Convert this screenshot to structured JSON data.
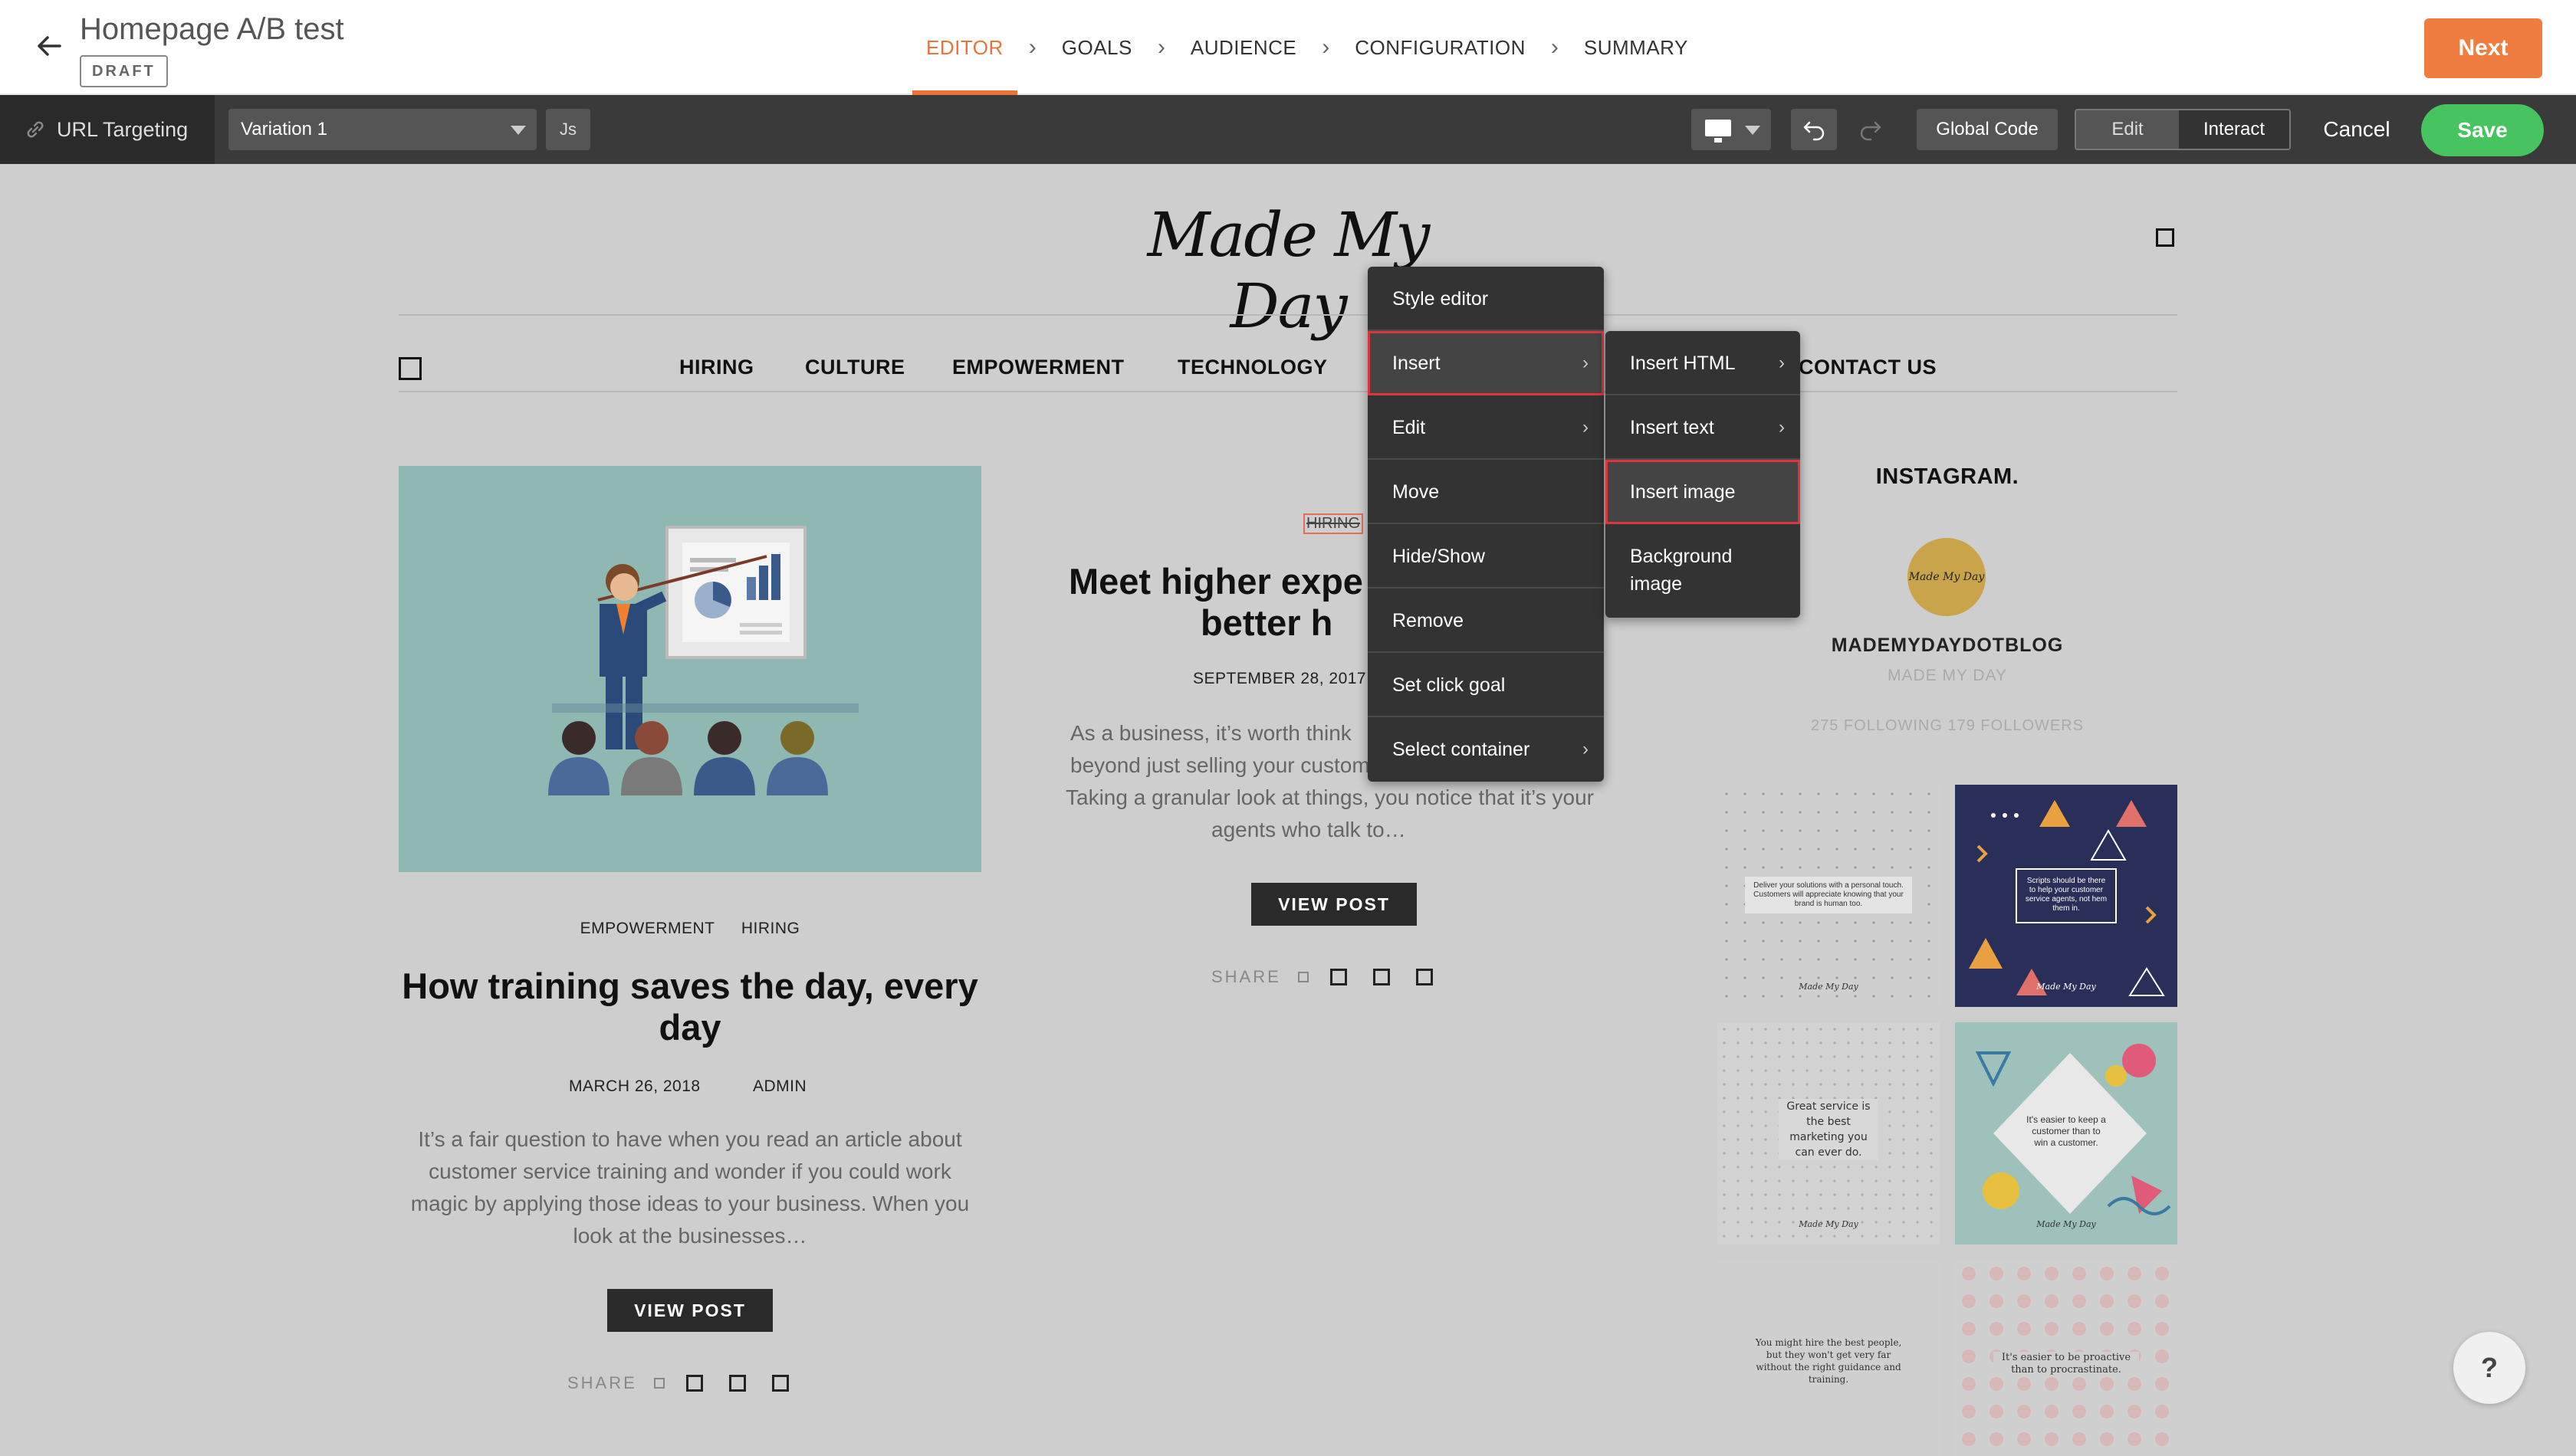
{
  "header": {
    "title": "Homepage A/B test",
    "status": "DRAFT",
    "steps": [
      "EDITOR",
      "GOALS",
      "AUDIENCE",
      "CONFIGURATION",
      "SUMMARY"
    ],
    "active_step": "EDITOR",
    "next_label": "Next",
    "accent_color": "#ef7d3f"
  },
  "toolbar": {
    "url_targeting": "URL Targeting",
    "variation": "Variation 1",
    "js_label": "Js",
    "global_code": "Global Code",
    "mode_edit": "Edit",
    "mode_interact": "Interact",
    "active_mode": "Interact",
    "cancel": "Cancel",
    "save": "Save",
    "save_color": "#47c45f"
  },
  "site": {
    "logo": "Made My Day",
    "nav": [
      "HIRING",
      "CULTURE",
      "EMPOWERMENT",
      "TECHNOLOGY",
      "CONTACT US"
    ]
  },
  "posts": [
    {
      "categories": [
        "EMPOWERMENT",
        "HIRING"
      ],
      "title": "How training saves the day, every day",
      "date": "MARCH 26, 2018",
      "author": "ADMIN",
      "excerpt": "It’s a fair question to have when you read an article about customer service training and wonder if you could work magic by applying those ideas to your business. When you look at the businesses…",
      "button": "VIEW POST",
      "share": "SHARE"
    },
    {
      "category": "HIRING",
      "title": "Meet higher expe better h",
      "title_line1": "Meet higher expe",
      "title_line2": "better h",
      "date": "SEPTEMBER 28, 2017",
      "excerpt_lines": [
        "As a business, it’s worth think",
        "beyond just selling your custom",
        "Taking a granular look at things, you notice that it’s your",
        "agents who talk to…"
      ],
      "button": "VIEW POST",
      "share": "SHARE"
    }
  ],
  "instagram": {
    "title": "INSTAGRAM.",
    "avatar_text": "Made My Day",
    "handle": "MADEMYDAYDOTBLOG",
    "name": "MADE MY DAY",
    "stats": "275 FOLLOWING   179 FOLLOWERS",
    "tiles": [
      {
        "text": "Deliver your solutions with a personal touch. Customers will appreciate knowing that your brand is human too.",
        "brand": "Made My Day"
      },
      {
        "text": "Scripts should be there to help your customer service agents, not hem them in.",
        "brand": "Made My Day"
      },
      {
        "text": "Great service is the best marketing you can ever do.",
        "brand": "Made My Day"
      },
      {
        "text": "It's easier to keep a customer than to win a customer.",
        "brand": "Made My Day"
      },
      {
        "text": "You might hire the best people, but they won't get very far without the right guidance and training.",
        "brand": ""
      },
      {
        "text": "It's easier to be proactive than to procrastinate.",
        "brand": ""
      }
    ]
  },
  "context_menu": {
    "items": [
      {
        "label": "Style editor",
        "submenu": false
      },
      {
        "label": "Insert",
        "submenu": true,
        "highlight": true
      },
      {
        "label": "Edit",
        "submenu": true
      },
      {
        "label": "Move",
        "submenu": false
      },
      {
        "label": "Hide/Show",
        "submenu": false
      },
      {
        "label": "Remove",
        "submenu": false
      },
      {
        "label": "Set click goal",
        "submenu": false
      },
      {
        "label": "Select container",
        "submenu": true
      }
    ],
    "insert_submenu": [
      {
        "label": "Insert HTML",
        "submenu": true
      },
      {
        "label": "Insert text",
        "submenu": true
      },
      {
        "label": "Insert image",
        "submenu": false,
        "highlight": true
      },
      {
        "label": "Background image",
        "submenu": false
      }
    ],
    "highlight_color": "#d9363e"
  },
  "help": "?"
}
